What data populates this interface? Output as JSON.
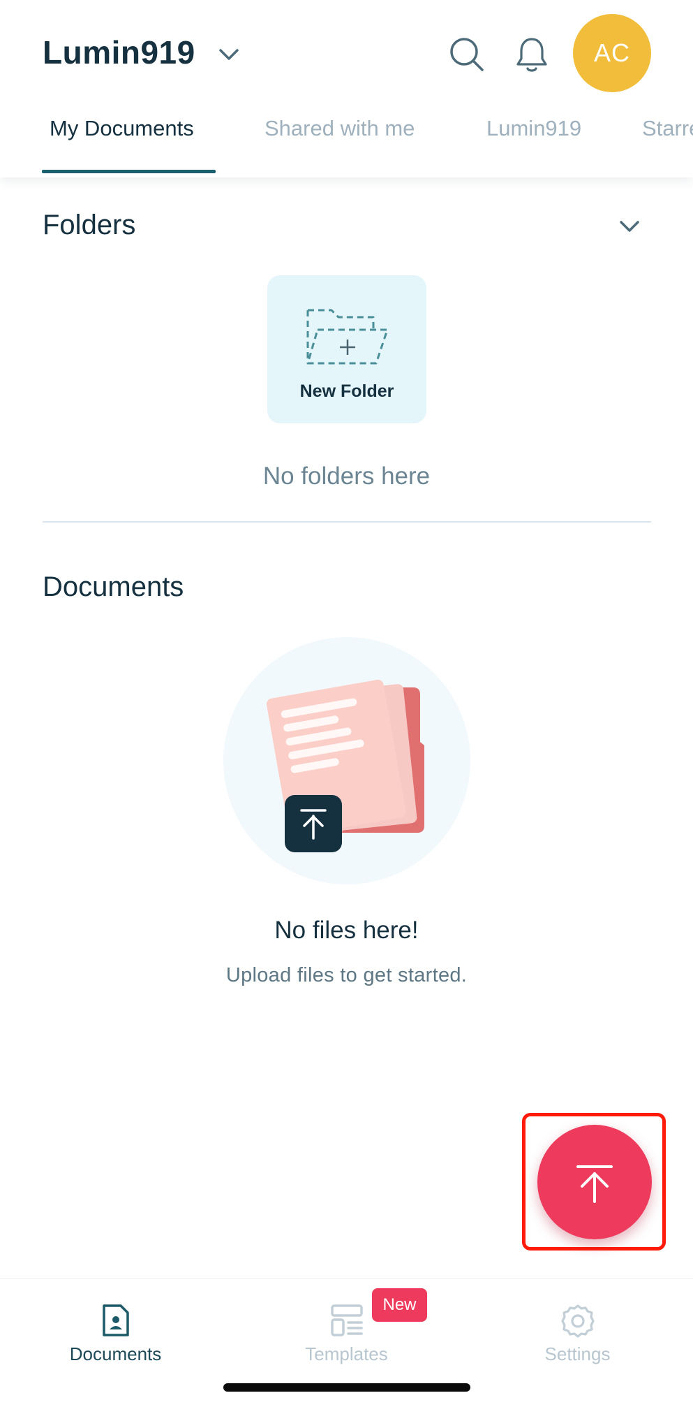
{
  "header": {
    "workspace_name": "Lumin919",
    "avatar_initials": "AC",
    "avatar_color": "#f1bd3a"
  },
  "tabs": [
    {
      "label": "My Documents",
      "active": true
    },
    {
      "label": "Shared with me",
      "active": false
    },
    {
      "label": "Lumin919",
      "active": false
    },
    {
      "label": "Starred",
      "active": false
    }
  ],
  "folders": {
    "title": "Folders",
    "new_folder_label": "New Folder",
    "empty_text": "No folders here"
  },
  "documents": {
    "title": "Documents",
    "empty_title": "No files here!",
    "empty_subtitle": "Upload files to get started."
  },
  "fab": {
    "icon": "upload-icon",
    "color": "#ee3a5c"
  },
  "bottom_nav": {
    "items": [
      {
        "label": "Documents",
        "icon": "document-icon",
        "active": true
      },
      {
        "label": "Templates",
        "icon": "templates-icon",
        "active": false
      },
      {
        "label": "Settings",
        "icon": "settings-gear-icon",
        "active": false
      }
    ],
    "templates_badge": "New"
  }
}
